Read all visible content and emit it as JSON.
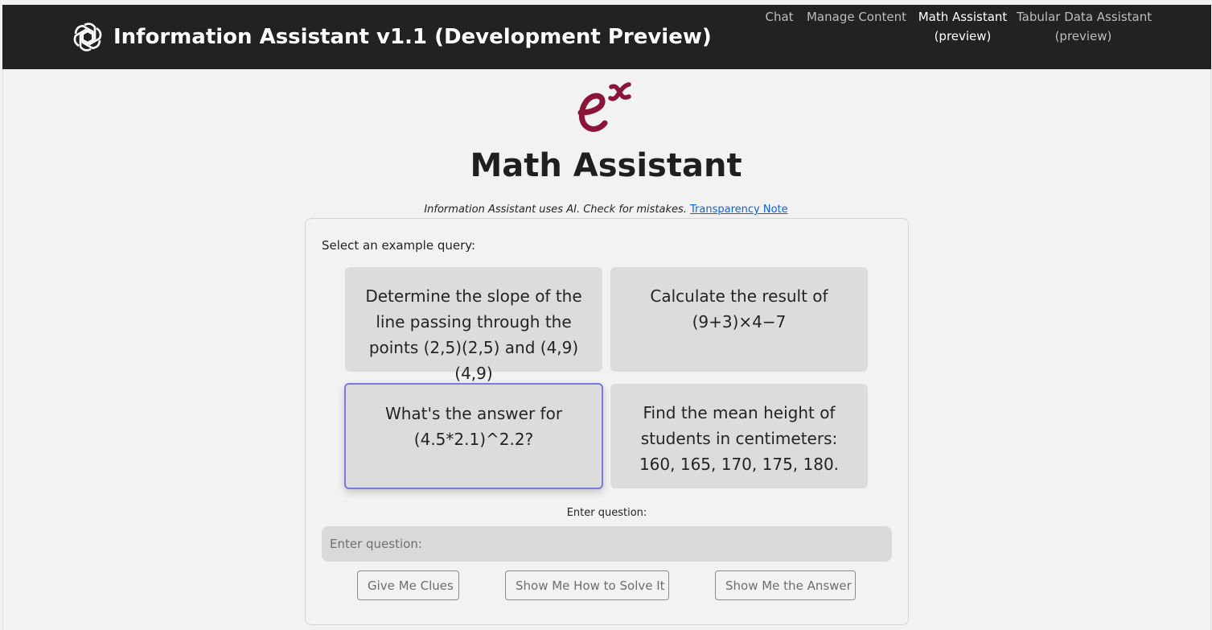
{
  "header": {
    "brand_icon": "openai-logo-icon",
    "title": "Information Assistant v1.1 (Development Preview)",
    "background": "#222222"
  },
  "nav": {
    "chat": "Chat",
    "manage_content": "Manage Content",
    "math_line1": "Math Assistant",
    "math_line2": "(preview)",
    "tabular_line1": "Tabular Data Assistant",
    "tabular_line2": "(preview)",
    "active": "Math Assistant"
  },
  "hero": {
    "logo_icon": "exponent-e-x-icon",
    "logo_color": "#8b1538",
    "title": "Math Assistant"
  },
  "disclaimer": {
    "text": "Information Assistant uses AI. Check for mistakes.",
    "link": "Transparency Note"
  },
  "examples": {
    "label": "Select an example query:",
    "items": [
      "Determine the slope of the line passing through the points (2,5)(2,5) and (4,9)(4,9)",
      "Calculate the result of (9+3)×4−7",
      "What's the answer for (4.5*2.1)^2.2?",
      "Find the mean height of students in centimeters: 160, 165, 170, 175, 180."
    ],
    "selected_index": 2,
    "selected_border_color": "#7b7bdc"
  },
  "question": {
    "label": "Enter question:",
    "placeholder": "Enter question:",
    "value": ""
  },
  "actions": {
    "clues": "Give Me Clues",
    "how_to_solve": "Show Me How to Solve It",
    "answer": "Show Me the Answer"
  }
}
